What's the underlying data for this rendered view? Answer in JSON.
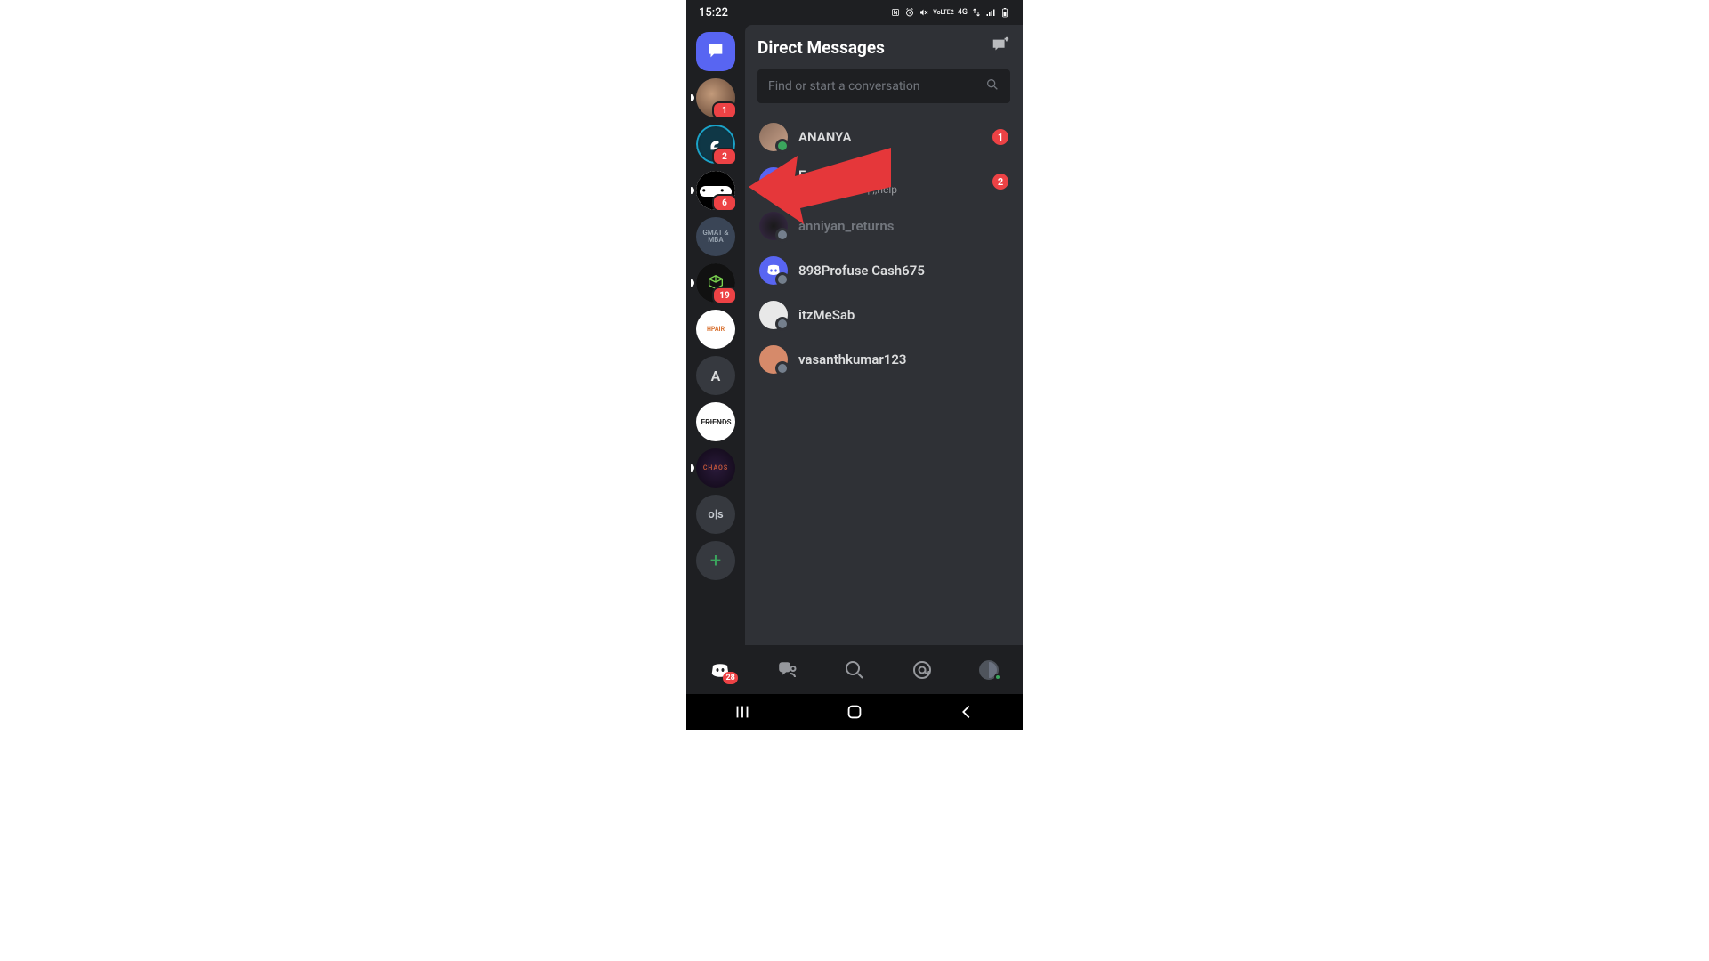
{
  "status_bar": {
    "time": "15:22",
    "network_label": "4G",
    "carrier_tech": "VoLTE2"
  },
  "header": {
    "title": "Direct Messages"
  },
  "search": {
    "placeholder": "Find or start a conversation"
  },
  "servers": [
    {
      "id": "dm",
      "type": "dm-home",
      "selected": true
    },
    {
      "id": "s1",
      "type": "avatar",
      "badge": "1"
    },
    {
      "id": "s2",
      "type": "swan",
      "badge": "2"
    },
    {
      "id": "s3",
      "type": "ninja",
      "badge": "6"
    },
    {
      "id": "s4",
      "type": "text",
      "label": "GMAT & MBA"
    },
    {
      "id": "s5",
      "type": "cube",
      "badge": "19"
    },
    {
      "id": "s6",
      "type": "text-orange",
      "label": "HPAIR"
    },
    {
      "id": "s7",
      "type": "letter",
      "label": "A"
    },
    {
      "id": "s8",
      "type": "friends",
      "label": "F·R·I·E·N·D·S"
    },
    {
      "id": "s9",
      "type": "chaos",
      "label": "CHAOS"
    },
    {
      "id": "s10",
      "type": "ols",
      "label": "o|s"
    },
    {
      "id": "add",
      "type": "add"
    }
  ],
  "dms": [
    {
      "name": "ANANYA",
      "status": "",
      "badge": "1",
      "online": true,
      "dim": false
    },
    {
      "name": "Fr",
      "status": "Playing music | ;;help",
      "badge": "2",
      "online": true,
      "dim": false
    },
    {
      "name": "anniyan_returns",
      "status": "",
      "badge": "",
      "online": false,
      "dim": true
    },
    {
      "name": "898Profuse Cash675",
      "status": "",
      "badge": "",
      "online": false,
      "dim": false
    },
    {
      "name": "itzMeSab",
      "status": "",
      "badge": "",
      "online": false,
      "dim": false
    },
    {
      "name": "vasanthkumar123",
      "status": "",
      "badge": "",
      "online": false,
      "dim": false
    }
  ],
  "tabs": {
    "home_badge": "28"
  }
}
